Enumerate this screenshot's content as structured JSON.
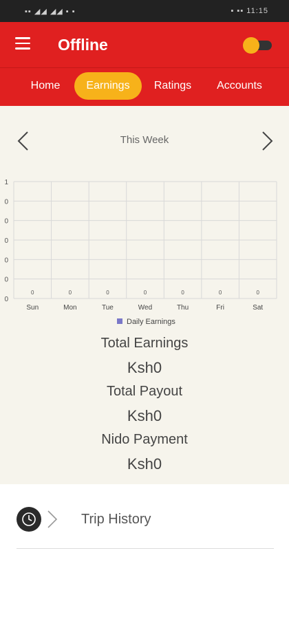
{
  "statusbar": {
    "left": "▪▪ ◢◢ ◢◢ ▪ ▪",
    "right": "▪ ▪▪ 11:15"
  },
  "header": {
    "title": "Offline"
  },
  "tabs": [
    {
      "label": "Home",
      "active": false
    },
    {
      "label": "Earnings",
      "active": true
    },
    {
      "label": "Ratings",
      "active": false
    },
    {
      "label": "Accounts",
      "active": false
    }
  ],
  "period": {
    "label": "This Week"
  },
  "chart_data": {
    "type": "bar",
    "categories": [
      "Sun",
      "Mon",
      "Tue",
      "Wed",
      "Thu",
      "Fri",
      "Sat"
    ],
    "series": [
      {
        "name": "Daily Earnings",
        "values": [
          0,
          0,
          0,
          0,
          0,
          0,
          0
        ]
      }
    ],
    "y_tick_labels": [
      "1",
      "0",
      "0",
      "0",
      "0",
      "0",
      "0"
    ],
    "ylim": [
      0,
      1
    ],
    "grid": true,
    "legend": "bottom",
    "series_color": "#7a78c8"
  },
  "summary": [
    {
      "label": "Total Earnings",
      "value": "Ksh0"
    },
    {
      "label": "Total Payout",
      "value": "Ksh0"
    },
    {
      "label": "Nido Payment",
      "value": "Ksh0"
    }
  ],
  "history": {
    "label": "Trip History"
  },
  "colors": {
    "brand_red": "#e02020",
    "accent_yellow": "#f7b21a",
    "background": "#f6f4ec"
  }
}
